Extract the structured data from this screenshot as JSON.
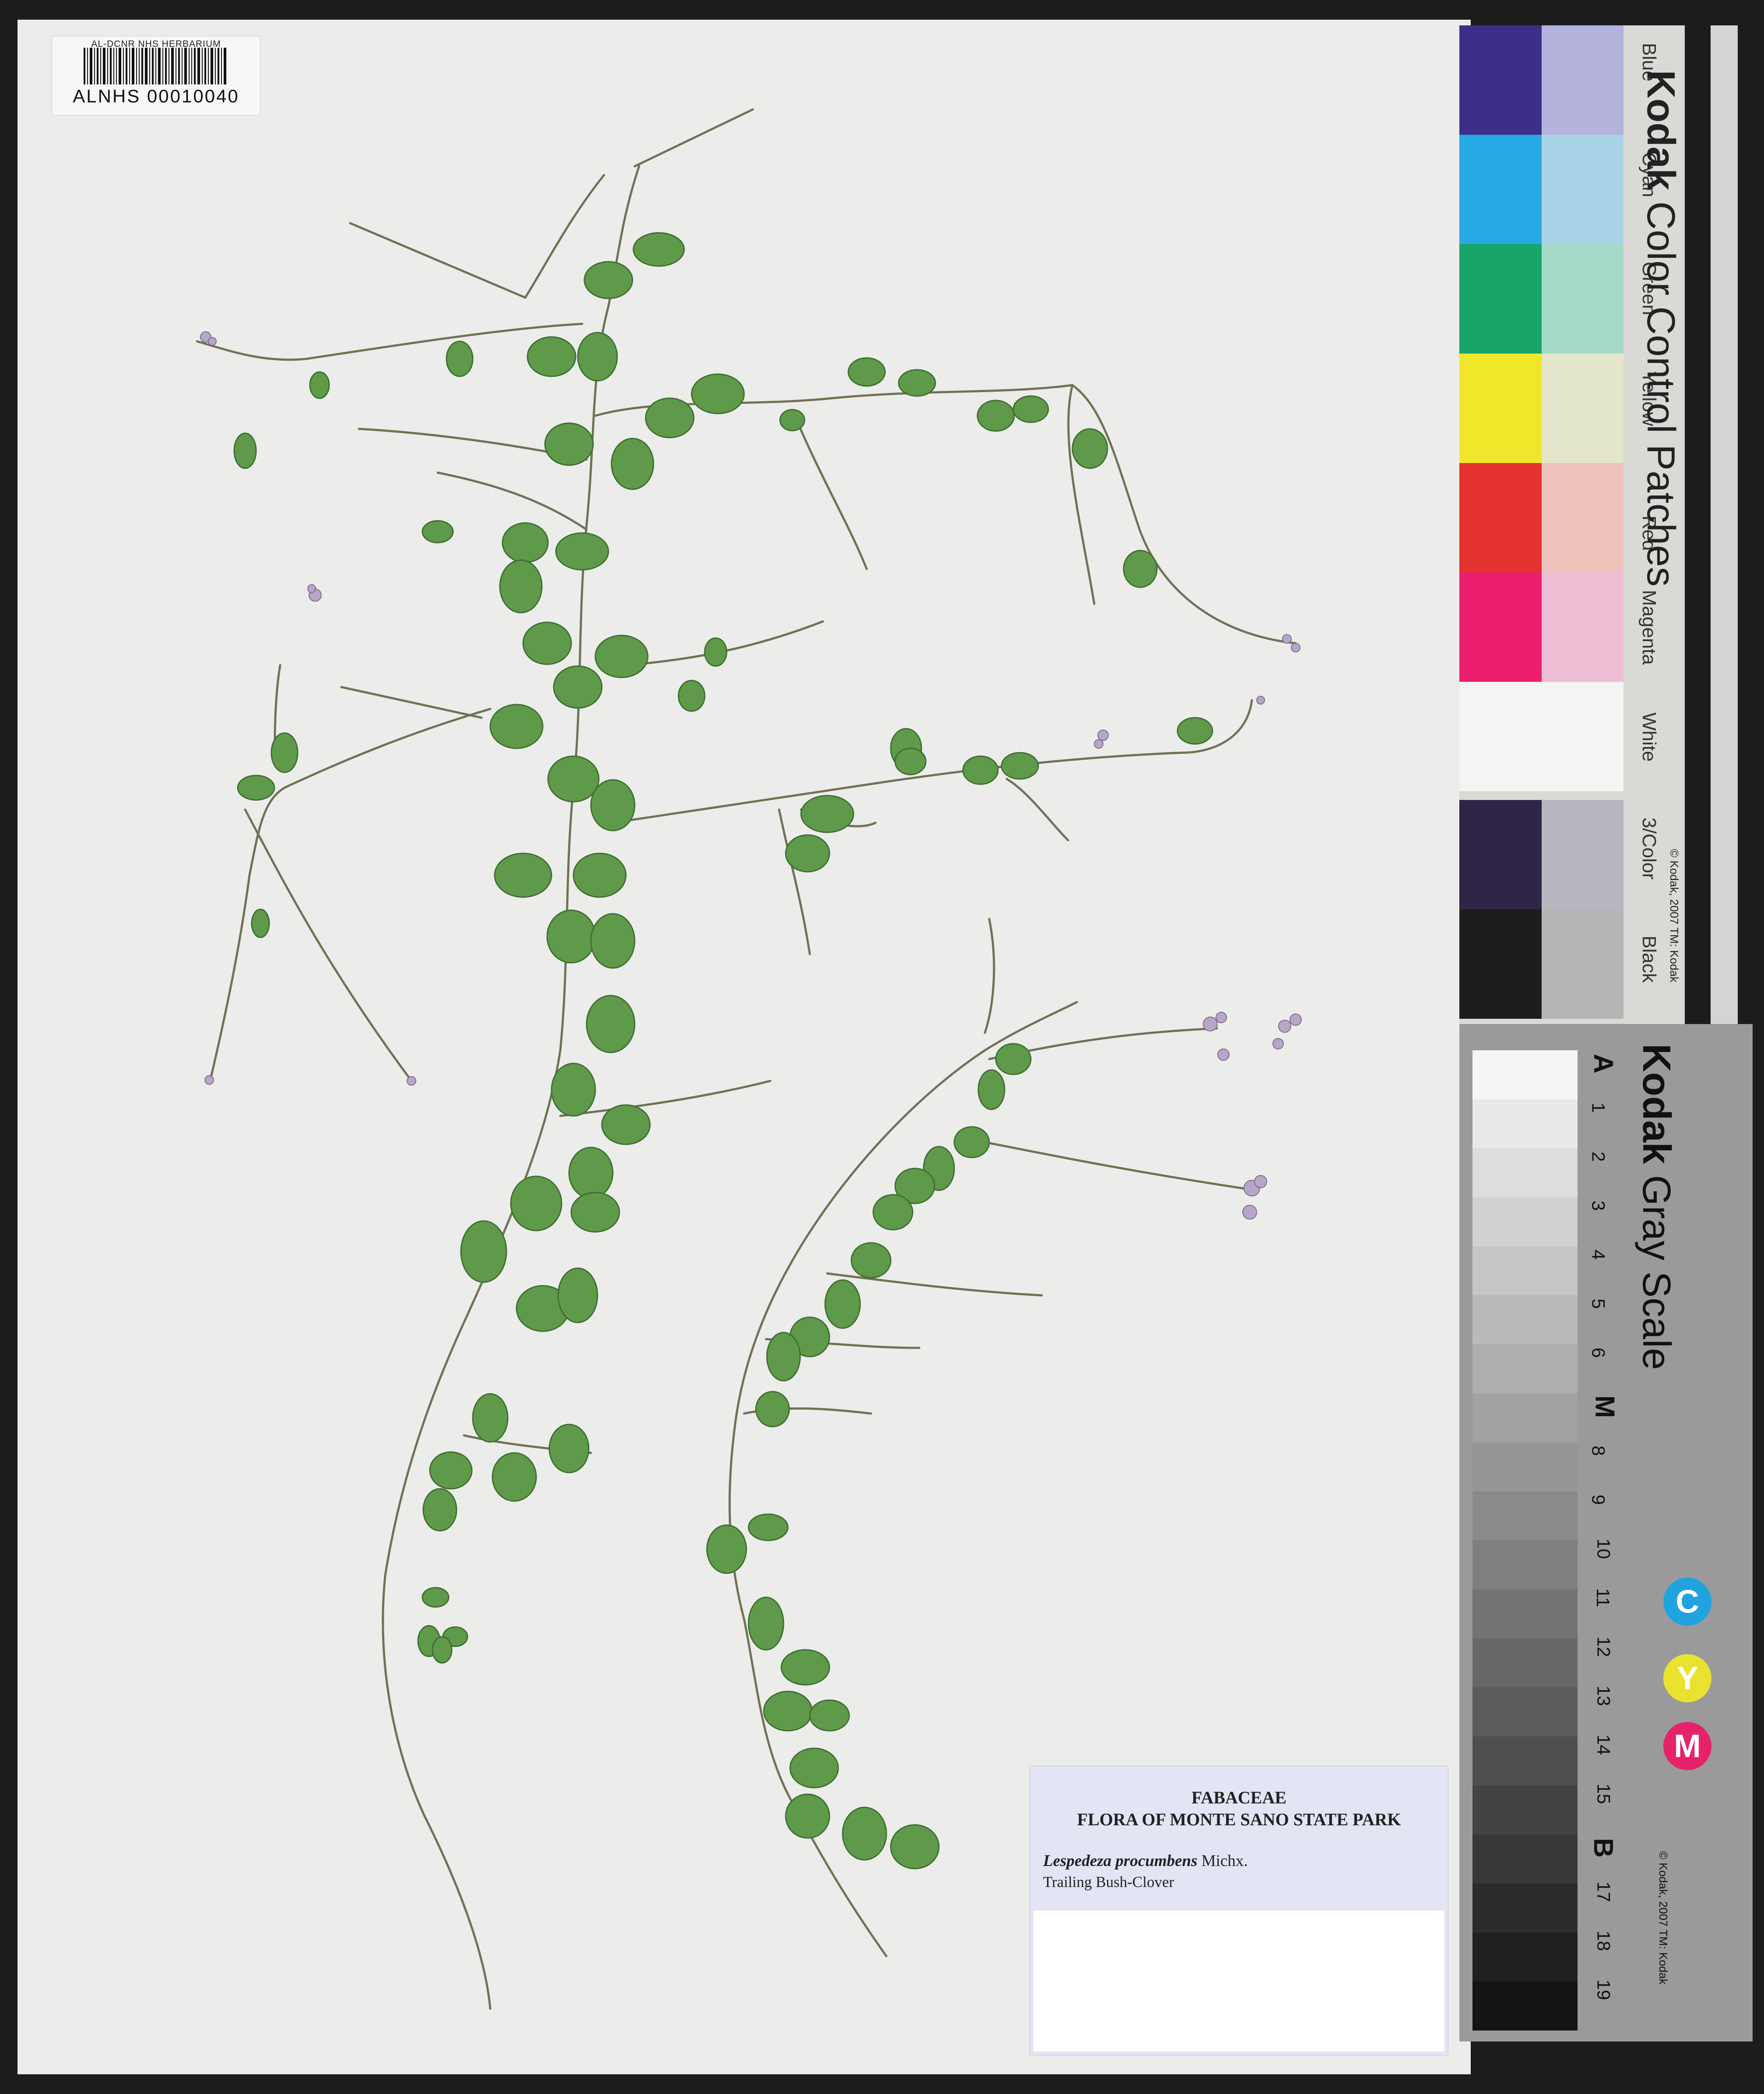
{
  "barcode": {
    "header": "AL-DCNR NHS HERBARIUM",
    "number": "ALNHS 00010040"
  },
  "color_chart": {
    "brand": "Kodak",
    "title": "Color Control Patches",
    "copyright": "© Kodak, 2007  TM: Kodak",
    "patches": [
      {
        "label": "Blue",
        "dark": "#3b2f8a",
        "light": "#b3b3dd"
      },
      {
        "label": "Cyan",
        "dark": "#27a9e3",
        "light": "#a9d3e6"
      },
      {
        "label": "Green",
        "dark": "#17a56a",
        "light": "#a7d9c9"
      },
      {
        "label": "Yellow",
        "dark": "#f0e72b",
        "light": "#e3e6c9"
      },
      {
        "label": "Red",
        "dark": "#e3322f",
        "light": "#edc3bb"
      },
      {
        "label": "Magenta",
        "dark": "#ec1f6e",
        "light": "#ecbdd3"
      },
      {
        "label": "White",
        "dark": "#f4f4f2",
        "light": "#f4f4f2"
      },
      {
        "label": "3/Color",
        "dark": "#2f2546",
        "light": "#b7b6c1"
      },
      {
        "label": "Black",
        "dark": "#1d1d1d",
        "light": "#b6b6b6"
      }
    ]
  },
  "gray_scale": {
    "brand": "Kodak",
    "title": "Gray Scale",
    "copyright": "© Kodak, 2007  TM: Kodak",
    "steps": [
      "A",
      "1",
      "2",
      "3",
      "4",
      "5",
      "6",
      "M",
      "8",
      "9",
      "10",
      "11",
      "12",
      "13",
      "14",
      "15",
      "B",
      "17",
      "18",
      "19"
    ],
    "cym": [
      {
        "letter": "C",
        "color": "#21a3e0"
      },
      {
        "letter": "Y",
        "color": "#e9e22e"
      },
      {
        "letter": "M",
        "color": "#e7226c"
      }
    ]
  },
  "label": {
    "family": "FABACEAE",
    "flora": "FLORA OF MONTE SANO STATE PARK",
    "species": "Lespedeza procumbens",
    "authority": "Michx.",
    "common_name": "Trailing Bush-Clover"
  }
}
